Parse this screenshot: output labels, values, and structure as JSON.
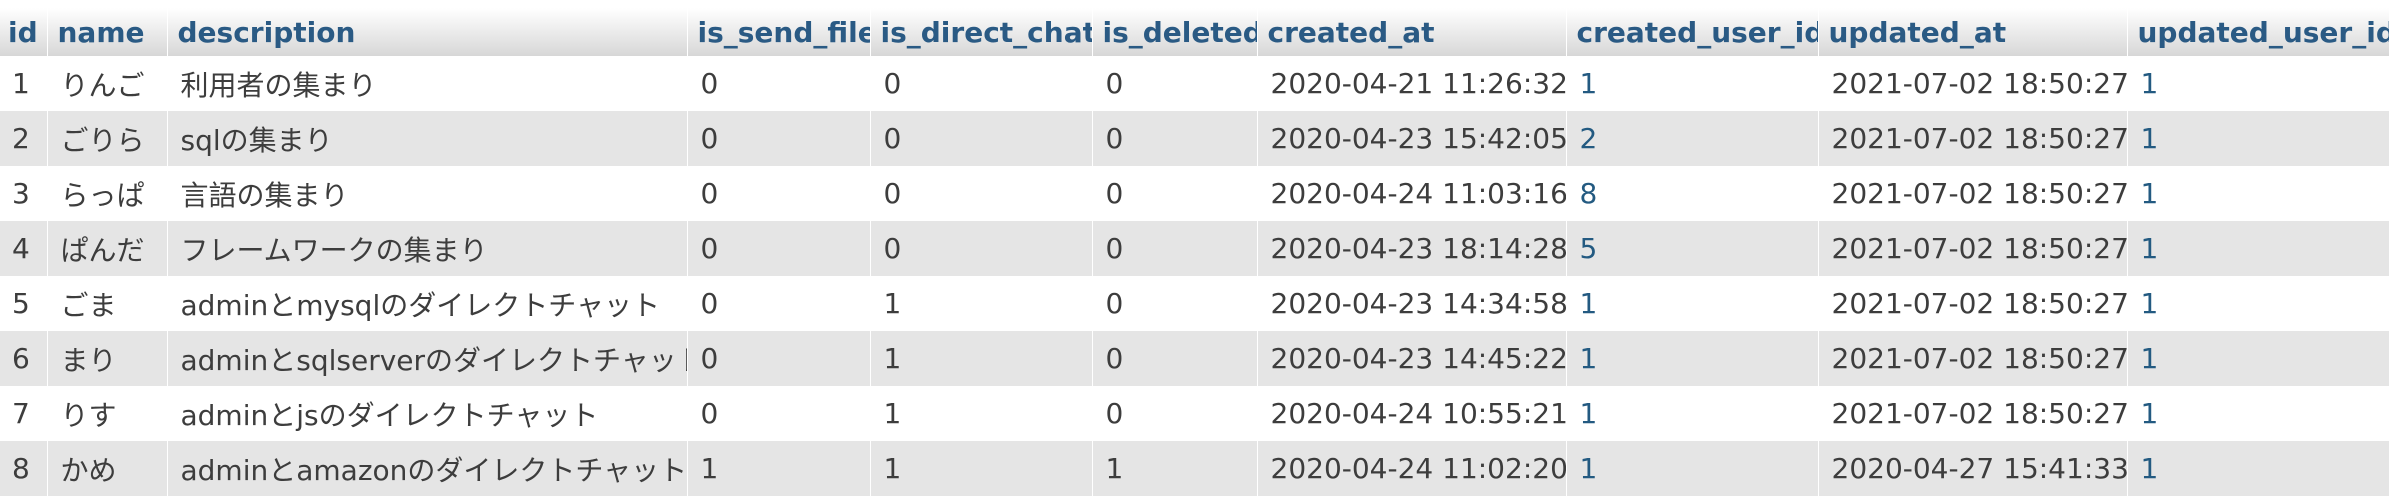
{
  "columns": {
    "id": "id",
    "name": "name",
    "description": "description",
    "is_send_file": "is_send_file",
    "is_direct_chat": "is_direct_chat",
    "is_deleted": "is_deleted",
    "created_at": "created_at",
    "created_user_id": "created_user_id",
    "updated_at": "updated_at",
    "updated_user_id": "updated_user_id"
  },
  "rows": [
    {
      "id": "1",
      "name": "りんご",
      "description": "利用者の集まり",
      "is_send_file": "0",
      "is_direct_chat": "0",
      "is_deleted": "0",
      "created_at": "2020-04-21 11:26:32",
      "created_user_id": "1",
      "updated_at": "2021-07-02 18:50:27",
      "updated_user_id": "1"
    },
    {
      "id": "2",
      "name": "ごりら",
      "description": "sqlの集まり",
      "is_send_file": "0",
      "is_direct_chat": "0",
      "is_deleted": "0",
      "created_at": "2020-04-23 15:42:05",
      "created_user_id": "2",
      "updated_at": "2021-07-02 18:50:27",
      "updated_user_id": "1"
    },
    {
      "id": "3",
      "name": "らっぱ",
      "description": "言語の集まり",
      "is_send_file": "0",
      "is_direct_chat": "0",
      "is_deleted": "0",
      "created_at": "2020-04-24 11:03:16",
      "created_user_id": "8",
      "updated_at": "2021-07-02 18:50:27",
      "updated_user_id": "1"
    },
    {
      "id": "4",
      "name": "ぱんだ",
      "description": "フレームワークの集まり",
      "is_send_file": "0",
      "is_direct_chat": "0",
      "is_deleted": "0",
      "created_at": "2020-04-23 18:14:28",
      "created_user_id": "5",
      "updated_at": "2021-07-02 18:50:27",
      "updated_user_id": "1"
    },
    {
      "id": "5",
      "name": "ごま",
      "description": "adminとmysqlのダイレクトチャット",
      "is_send_file": "0",
      "is_direct_chat": "1",
      "is_deleted": "0",
      "created_at": "2020-04-23 14:34:58",
      "created_user_id": "1",
      "updated_at": "2021-07-02 18:50:27",
      "updated_user_id": "1"
    },
    {
      "id": "6",
      "name": "まり",
      "description": "adminとsqlserverのダイレクトチャット",
      "is_send_file": "0",
      "is_direct_chat": "1",
      "is_deleted": "0",
      "created_at": "2020-04-23 14:45:22",
      "created_user_id": "1",
      "updated_at": "2021-07-02 18:50:27",
      "updated_user_id": "1"
    },
    {
      "id": "7",
      "name": "りす",
      "description": "adminとjsのダイレクトチャット",
      "is_send_file": "0",
      "is_direct_chat": "1",
      "is_deleted": "0",
      "created_at": "2020-04-24 10:55:21",
      "created_user_id": "1",
      "updated_at": "2021-07-02 18:50:27",
      "updated_user_id": "1"
    },
    {
      "id": "8",
      "name": "かめ",
      "description": "adminとamazonのダイレクトチャット",
      "is_send_file": "1",
      "is_direct_chat": "1",
      "is_deleted": "1",
      "created_at": "2020-04-24 11:02:20",
      "created_user_id": "1",
      "updated_at": "2020-04-27 15:41:33",
      "updated_user_id": "1"
    }
  ]
}
